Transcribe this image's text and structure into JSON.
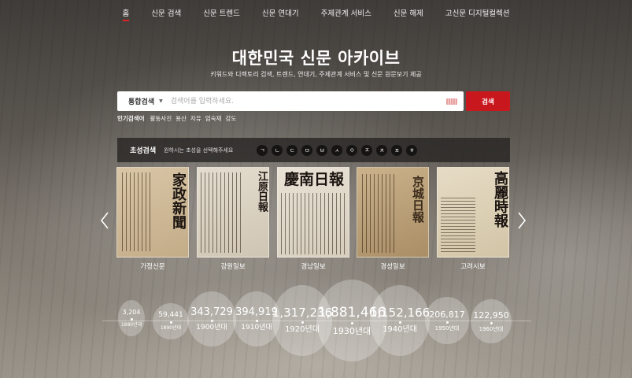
{
  "nav": {
    "items": [
      {
        "label": "홈",
        "active": true
      },
      {
        "label": "신문 검색"
      },
      {
        "label": "신문 트렌드"
      },
      {
        "label": "신문 연대기"
      },
      {
        "label": "주제관계 서비스"
      },
      {
        "label": "신문 해제"
      },
      {
        "label": "고신문 디지털컬렉션"
      }
    ]
  },
  "hero": {
    "title": "대한민국 신문 아카이브",
    "subtitle": "키워드와 디렉토리 검색, 트렌드, 연대기, 주제관계 서비스 및 신문 원문보기 제공"
  },
  "search": {
    "scope": "통합검색",
    "placeholder": "검색어를 입력하세요.",
    "value": "",
    "button": "검색"
  },
  "popular": {
    "label": "인기검색어",
    "terms": [
      "활동사진",
      "용산",
      "자유",
      "엄숙재",
      "강도"
    ]
  },
  "initial": {
    "label": "초성검색",
    "desc": "원하시는 초성을 선택해주세요",
    "consonants": [
      "ㄱ",
      "ㄴ",
      "ㄷ",
      "ㅁ",
      "ㅂ",
      "ㅅ",
      "ㅇ",
      "ㅈ",
      "ㅊ",
      "ㅍ",
      "ㅎ"
    ]
  },
  "papers": [
    {
      "name": "가정신문",
      "masthead": "家政新聞"
    },
    {
      "name": "강원일보",
      "masthead": "江原日報"
    },
    {
      "name": "경남일보",
      "masthead": "慶南日報"
    },
    {
      "name": "경성일보",
      "masthead": "京城日報"
    },
    {
      "name": "고려시보",
      "masthead": "高麗時報"
    }
  ],
  "decades": [
    {
      "count": "3,204",
      "label": "1880년대"
    },
    {
      "count": "59,441",
      "label": "1890년대"
    },
    {
      "count": "343,729",
      "label": "1900년대"
    },
    {
      "count": "394,919",
      "label": "1910년대"
    },
    {
      "count": "1,317,236",
      "label": "1920년대"
    },
    {
      "count": "1,881,466",
      "label": "1930년대"
    },
    {
      "count": "1,152,166",
      "label": "1940년대"
    },
    {
      "count": "206,817",
      "label": "1950년대"
    },
    {
      "count": "122,950",
      "label": "1960년대"
    }
  ],
  "icons": {
    "prev": "chevron-left-icon",
    "next": "chevron-right-icon",
    "keyboard": "keyboard-icon"
  },
  "colors": {
    "accent": "#c8181e"
  }
}
